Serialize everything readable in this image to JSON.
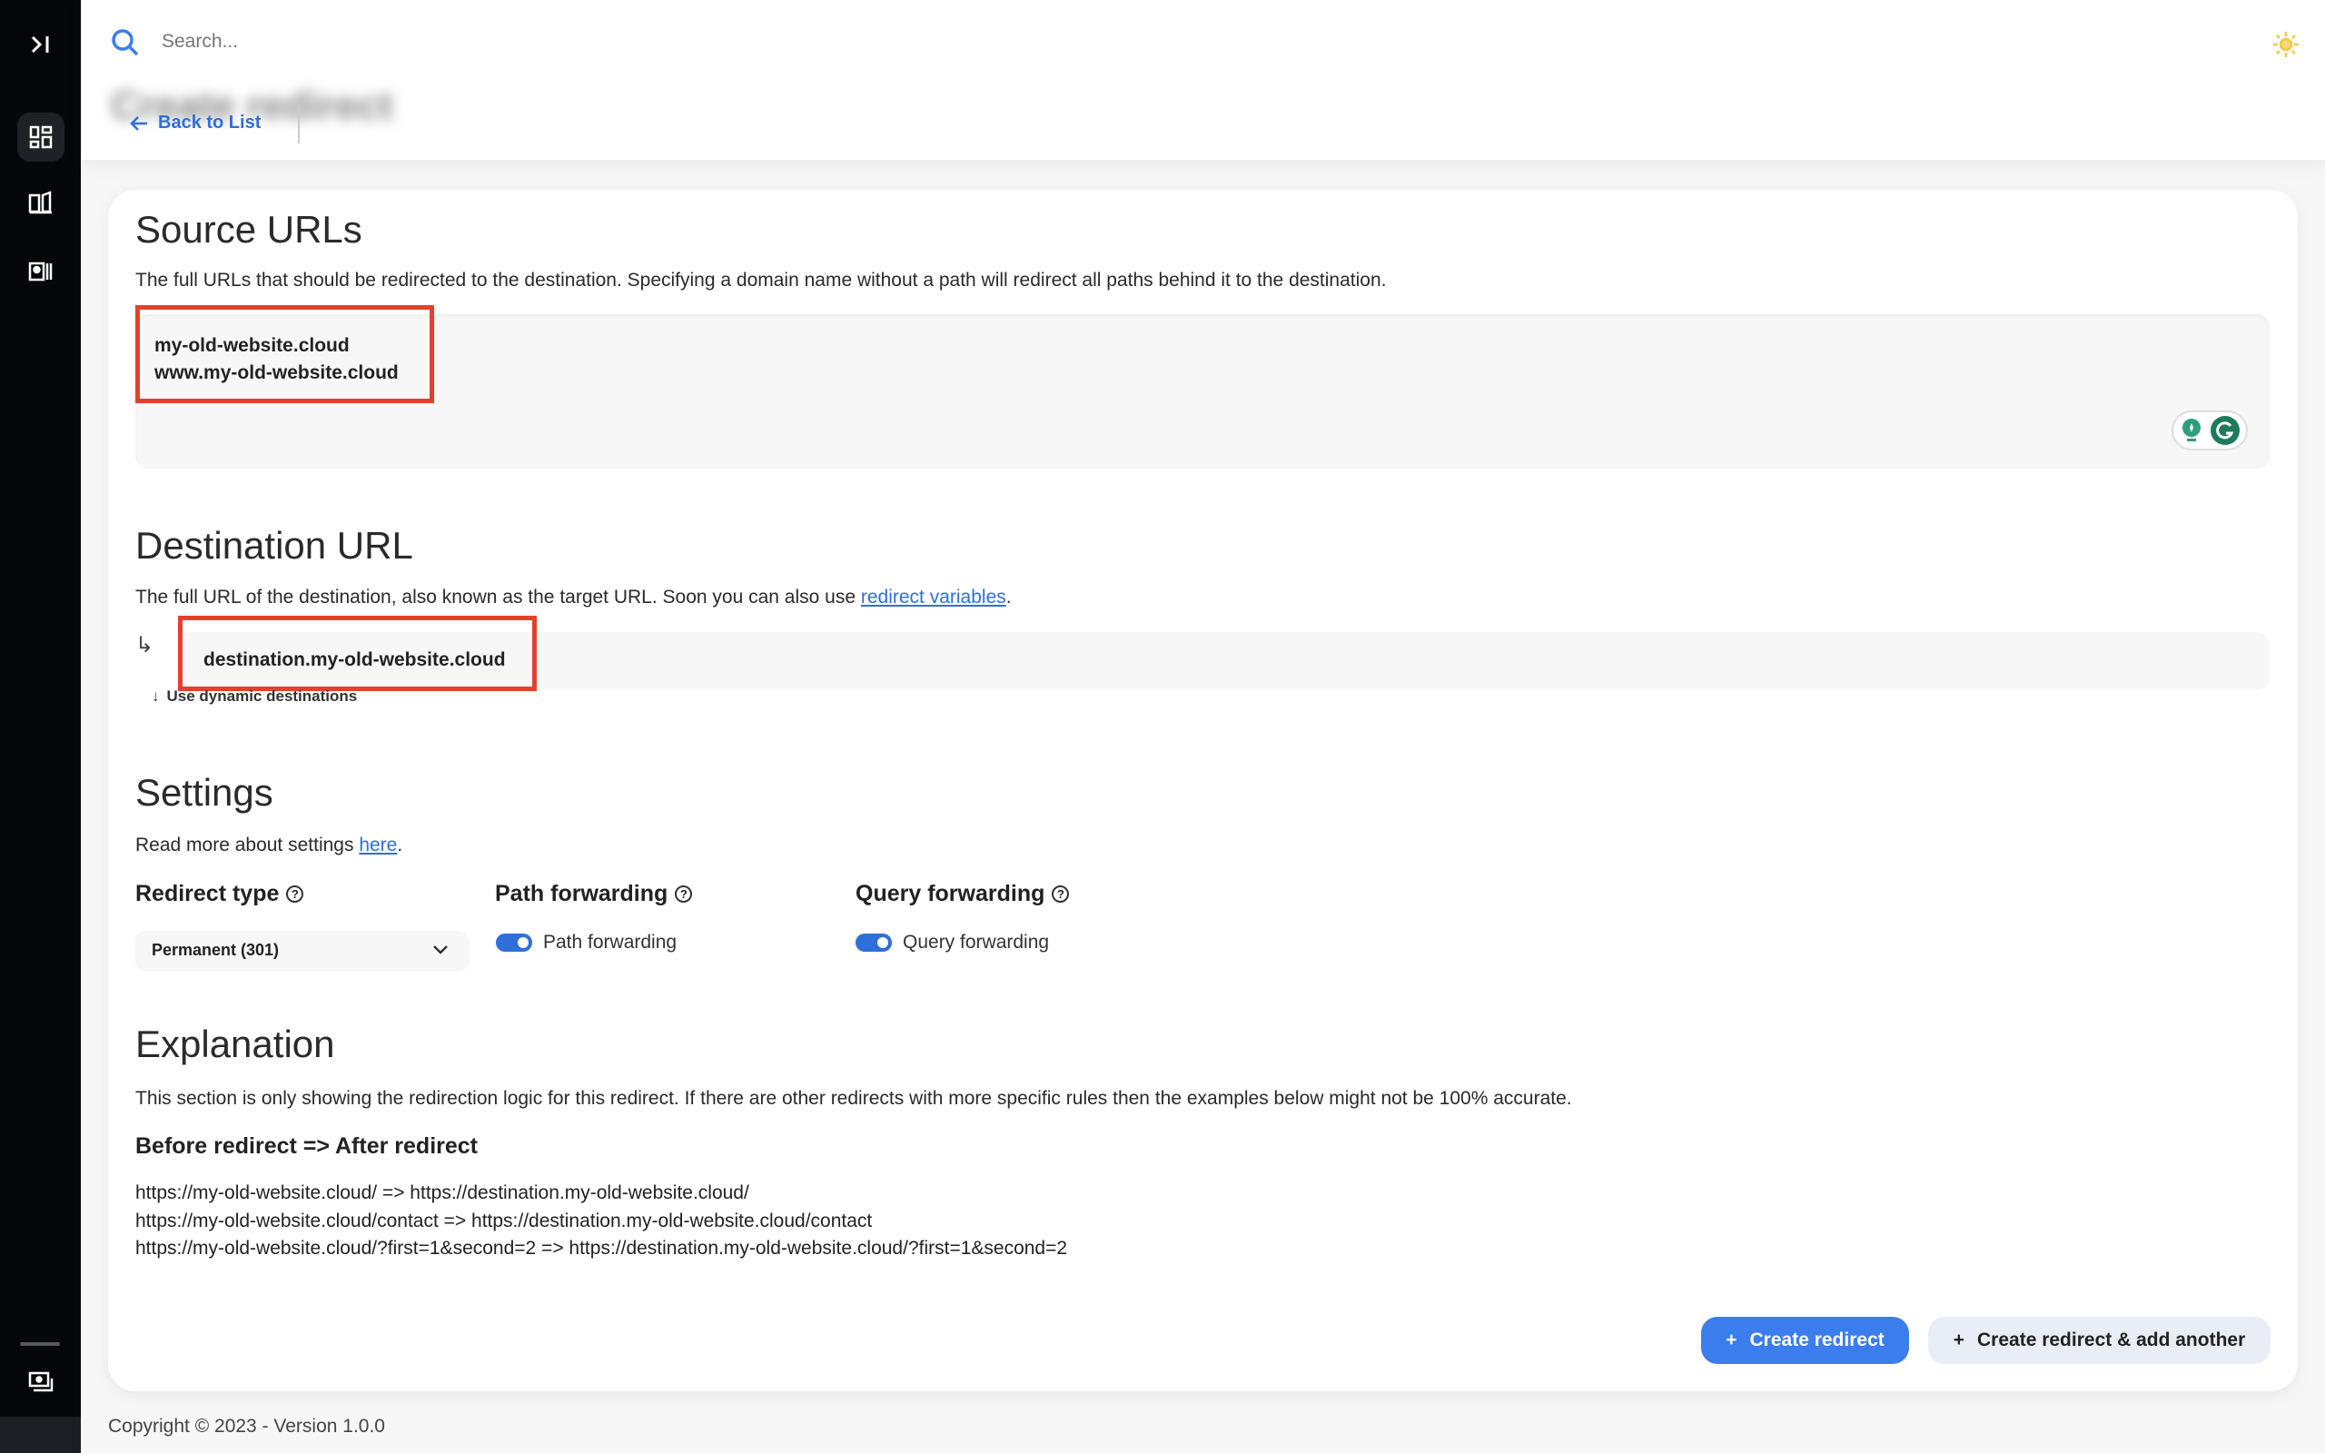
{
  "sidebar": {
    "items": [
      {
        "icon": "expand-sidebar-icon"
      },
      {
        "icon": "dashboard-icon",
        "active": true
      },
      {
        "icon": "book-icon"
      },
      {
        "icon": "contacts-icon"
      },
      {
        "icon": "billing-icon"
      }
    ]
  },
  "header": {
    "search_placeholder": "Search...",
    "back_label": "Back to List",
    "page_title": "Create redirect",
    "theme_icon": "sun-icon"
  },
  "source": {
    "title": "Source URLs",
    "description": "The full URLs that should be redirected to the destination. Specifying a domain name without a path will redirect all paths behind it to the destination.",
    "urls": [
      "my-old-website.cloud",
      "www.my-old-website.cloud"
    ]
  },
  "destination": {
    "title": "Destination URL",
    "description": "The full URL of the destination, also known as the target URL. Soon you can also use ",
    "link": "redirect variables",
    "after": ".",
    "value": "destination.my-old-website.cloud",
    "dynamic_label": "Use dynamic destinations"
  },
  "settings": {
    "title": "Settings",
    "read_more": "Read more about settings ",
    "link": "here",
    "after": ".",
    "redirect_type": {
      "label": "Redirect type",
      "value": "Permanent (301)"
    },
    "path_forwarding": {
      "label": "Path forwarding",
      "toggle_label": "Path forwarding",
      "enabled": true
    },
    "query_forwarding": {
      "label": "Query forwarding",
      "toggle_label": "Query forwarding",
      "enabled": true
    }
  },
  "explanation": {
    "title": "Explanation",
    "description": "This section is only showing the redirection logic for this redirect. If there are other redirects with more specific rules then the examples below might not be 100% accurate.",
    "subtitle": "Before redirect => After redirect",
    "examples": [
      "https://my-old-website.cloud/ => https://destination.my-old-website.cloud/",
      "https://my-old-website.cloud/contact => https://destination.my-old-website.cloud/contact",
      "https://my-old-website.cloud/?first=1&second=2 => https://destination.my-old-website.cloud/?first=1&second=2"
    ]
  },
  "actions": {
    "create": "Create redirect",
    "create_another": "Create redirect & add another"
  },
  "footer": {
    "text": "Copyright © 2023 - Version 1.0.0"
  },
  "colors": {
    "accent": "#3b7ded",
    "highlight": "#e2412b",
    "sidebar": "#05070b"
  }
}
